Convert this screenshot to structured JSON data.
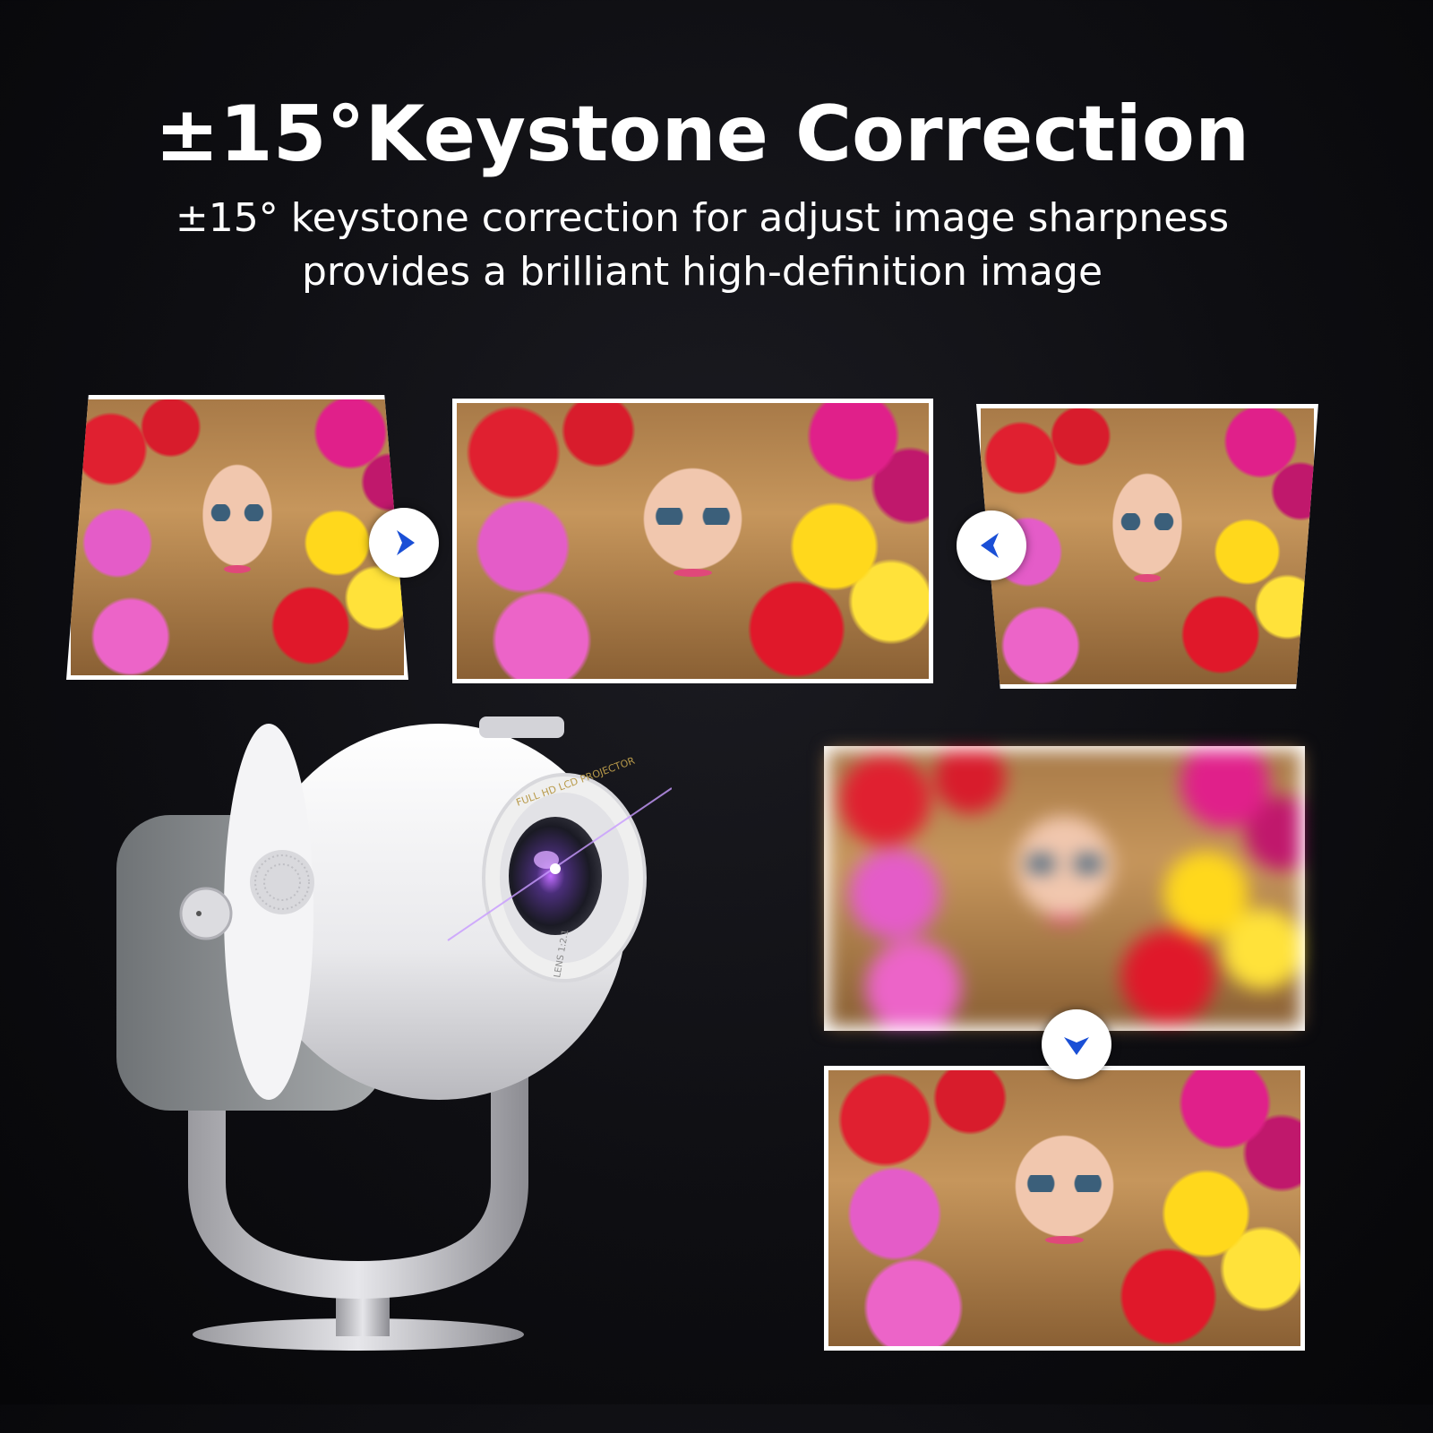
{
  "headline": "±15°Keystone Correction",
  "subtitle_line1": "±15° keystone correction for adjust image sharpness",
  "subtitle_line2": "provides a brilliant high-definition image",
  "lens_text": "FULL HD LCD PROJECTOR",
  "lens_text2": "LENS 1:2.1",
  "colors": {
    "arrow_blue": "#1a4fd6",
    "background": "#0e0e12"
  }
}
